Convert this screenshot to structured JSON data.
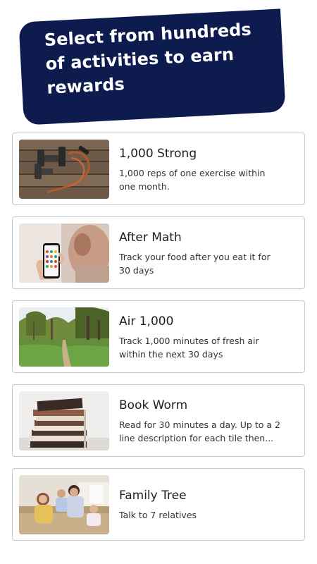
{
  "banner": {
    "line1": "Select from hundreds",
    "line2": "of activities to earn",
    "line3": "rewards"
  },
  "activities": [
    {
      "title": "1,000 Strong",
      "desc1": "1,000 reps of one exercise within",
      "desc2": "one month.",
      "image": "dumbbells-rope-photo"
    },
    {
      "title": "After Math",
      "desc1": "Track your food after you eat it for",
      "desc2": "30 days",
      "image": "phone-food-app-photo"
    },
    {
      "title": "Air 1,000",
      "desc1": "Track 1,000 minutes of fresh air",
      "desc2": "within the next 30 days",
      "image": "forest-path-photo"
    },
    {
      "title": "Book Worm",
      "desc1": "Read for 30 minutes a day. Up to a 2",
      "desc2": "line description for each tile then...",
      "image": "book-stack-photo"
    },
    {
      "title": "Family Tree",
      "desc1": "Talk to 7 relatives",
      "desc2": "",
      "image": "family-photo"
    }
  ],
  "colors": {
    "banner_bg": "#0d1b4f",
    "card_border": "#c9c9c9"
  }
}
